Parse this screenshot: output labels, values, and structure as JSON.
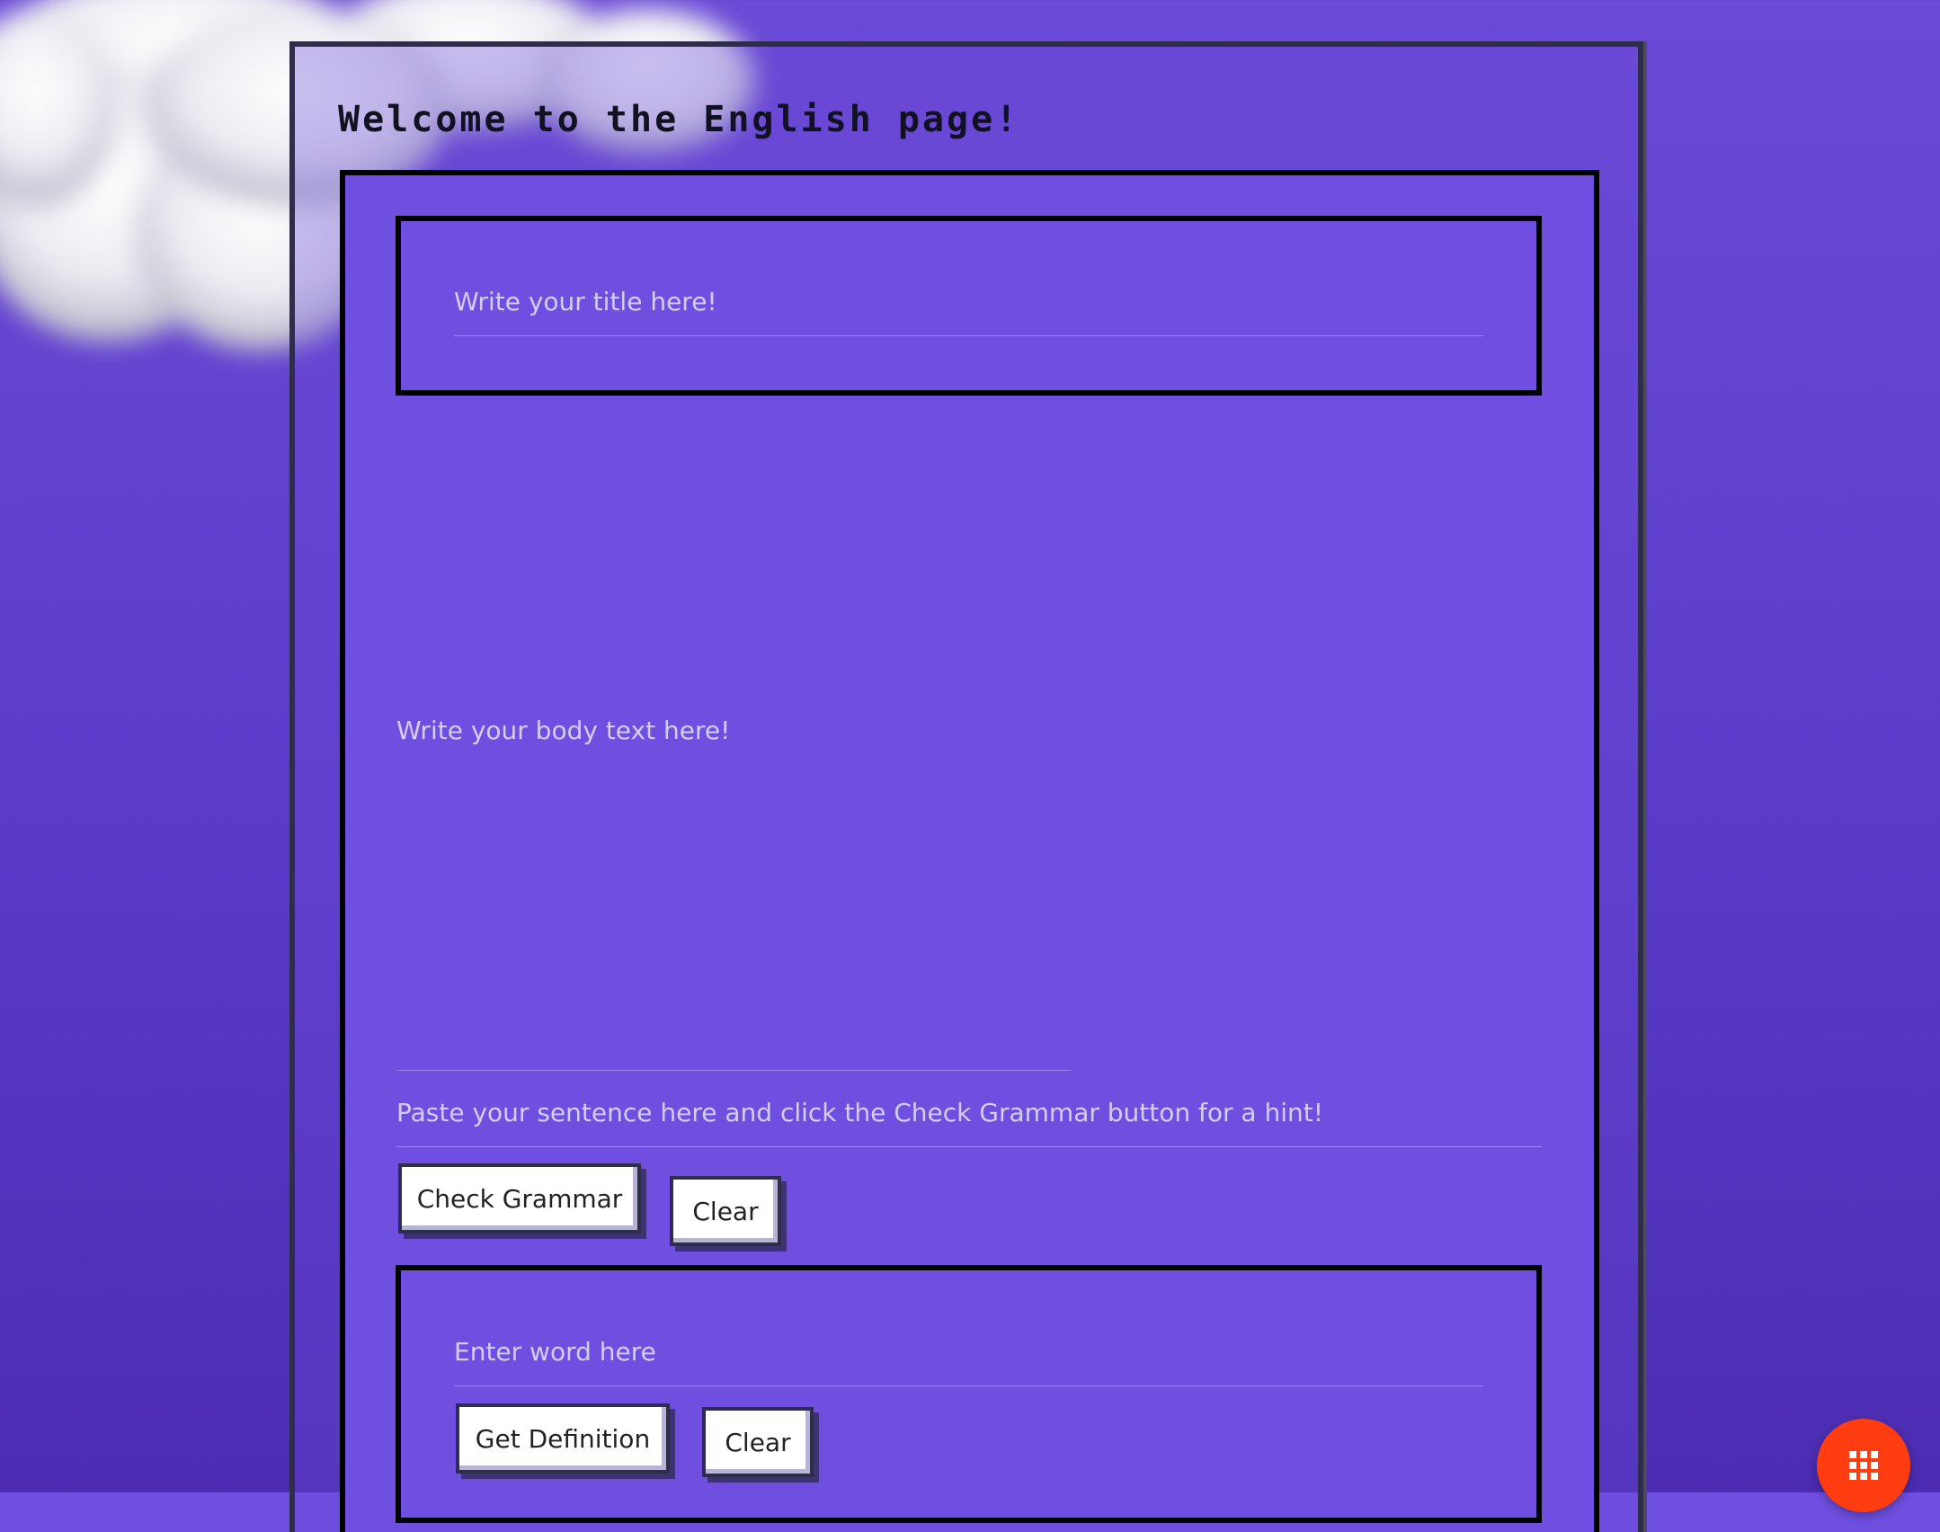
{
  "page": {
    "welcome_title": "Welcome to the English page!"
  },
  "title_field": {
    "placeholder": "Write your title here!",
    "value": ""
  },
  "body_field": {
    "placeholder": "Write your body text here!",
    "value": ""
  },
  "grammar": {
    "placeholder": "Paste your sentence here and click the Check Grammar button for a hint!",
    "value": "",
    "check_label": "Check Grammar",
    "clear_label": "Clear"
  },
  "definition": {
    "placeholder": "Enter word here",
    "value": "",
    "get_label": "Get Definition",
    "clear_label": "Clear"
  },
  "fab": {
    "icon": "apps-grid-icon",
    "color": "#ff3d10"
  },
  "colors": {
    "background": "#6a4ad6",
    "panel": "#6f4fe0",
    "border": "#000000"
  }
}
